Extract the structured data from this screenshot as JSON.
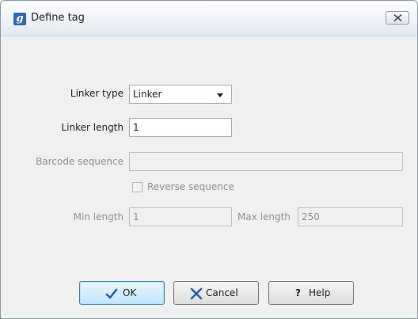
{
  "window": {
    "title": "Define tag",
    "app_icon_letter": "g"
  },
  "form": {
    "linker_type": {
      "label": "Linker type",
      "value": "Linker"
    },
    "linker_length": {
      "label": "Linker length",
      "value": "1"
    },
    "barcode_sequence": {
      "label": "Barcode sequence",
      "value": ""
    },
    "reverse_sequence": {
      "label": "Reverse sequence",
      "checked": false
    },
    "min_length": {
      "label": "Min length",
      "value": "1"
    },
    "max_length": {
      "label": "Max length",
      "value": "250"
    }
  },
  "buttons": {
    "ok": "OK",
    "cancel": "Cancel",
    "help": "Help",
    "help_glyph": "?"
  },
  "colors": {
    "accent": "#2d6cb5",
    "ok_icon": "#2b5ea8",
    "cancel_icon": "#2a5fa8",
    "disabled_text": "#8d8d8d"
  }
}
